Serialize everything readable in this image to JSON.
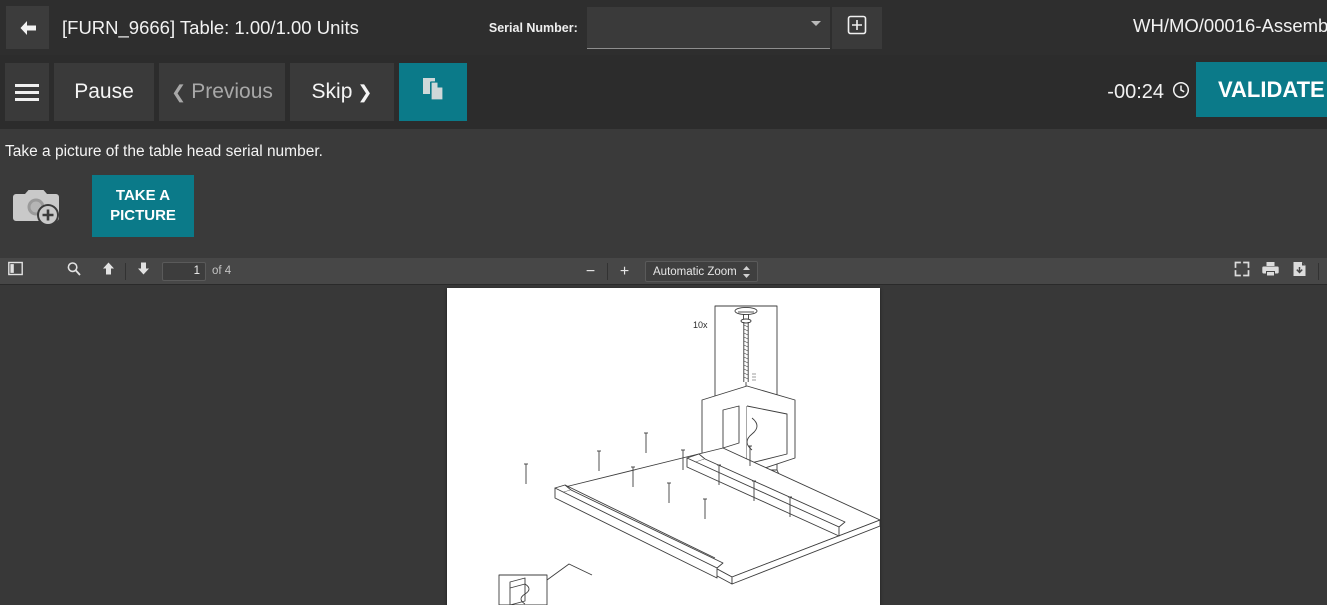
{
  "header": {
    "back_icon": "arrow-left-icon",
    "title": "[FURN_9666] Table: 1.00/1.00 Units",
    "serial_label": "Serial Number:",
    "serial_value": "",
    "serial_placeholder": "",
    "serial_dropdown_icon": "chevron-down-icon",
    "serial_add_icon": "plus-in-box-icon",
    "mo_reference": "WH/MO/00016-Assemb",
    "background_color": "#2e2e2e"
  },
  "toolbar": {
    "menu_icon": "hamburger-menu-icon",
    "pause_label": "Pause",
    "previous_label": "Previous",
    "previous_chevron": "chevron-left-icon",
    "skip_label": "Skip",
    "skip_chevron": "chevron-right-icon",
    "document_icon": "copy-document-icon",
    "timer_value": "-00:24",
    "clock_icon": "clock-icon",
    "validate_label": "VALIDATE",
    "accent_color": "#0b7a89"
  },
  "instruction": {
    "text": "Take a picture of the table head serial number.",
    "camera_icon": "add-photo-camera-icon",
    "take_picture_label_line1": "TAKE A",
    "take_picture_label_line2": "PICTURE",
    "panel_color": "#3a3a3a"
  },
  "pdf_toolbar": {
    "sidebar_icon": "sidebar-toggle-icon",
    "search_icon": "search-icon",
    "previous_page_icon": "arrow-up-icon",
    "next_page_icon": "arrow-down-icon",
    "page_number": "1",
    "page_count_label": "of 4",
    "zoom_out_icon": "minus-icon",
    "zoom_out_label": "−",
    "zoom_in_icon": "plus-icon",
    "zoom_in_label": "+",
    "zoom_level_label": "Automatic Zoom",
    "zoom_stepper_icon": "stepper-up-down-icon",
    "presentation_mode_icon": "fullscreen-icon",
    "print_icon": "printer-icon",
    "download_icon": "download-icon",
    "background_color": "#474747"
  },
  "pdf_document": {
    "page_background": "#ffffff",
    "viewer_background": "#383838",
    "diagram_label_10x": "10x",
    "diagram_description": "Furniture assembly instruction drawing: table top panel with side rails, dowels and screws, with two callout detail boxes"
  }
}
